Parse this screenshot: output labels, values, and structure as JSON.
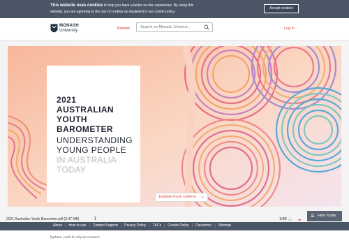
{
  "cookie_banner": {
    "heading": "This website uses cookies",
    "text_line1": "to help you have a better on-line experience. By using this",
    "text_line2": "website, you are agreeing to the use of cookies as explained in our cookie policy.",
    "accept_label": "Accept cookies"
  },
  "header": {
    "logo_line1": "MONASH",
    "logo_line2": "University",
    "browse_label": "Browse",
    "search_placeholder": "Search on Monash Universi...",
    "login_label": "Log in"
  },
  "document": {
    "title_lines": [
      "2021",
      "AUSTRALIAN",
      "YOUTH",
      "BAROMETER",
      "UNDERSTANDING",
      "YOUNG PEOPLE",
      "IN AUSTRALIA",
      "TODAY"
    ],
    "explore_label": "Explore more content",
    "file_name": "2021 Australian Youth Barometer.pdf (3.47 MB)",
    "page_count": "1/88",
    "hide_footer_label": "Hide footer"
  },
  "footer": {
    "links": [
      "About",
      "How to use",
      "Contact Support",
      "Privacy Policy",
      "T&Cs",
      "Cookie Policy",
      "Disclaimer",
      "Sitemap"
    ],
    "credit": "figshare. credit for all your research."
  },
  "colors": {
    "banner_bg": "#4a5566",
    "accent_red": "#d63a3a",
    "cover_peach": "#f6c8a8"
  }
}
